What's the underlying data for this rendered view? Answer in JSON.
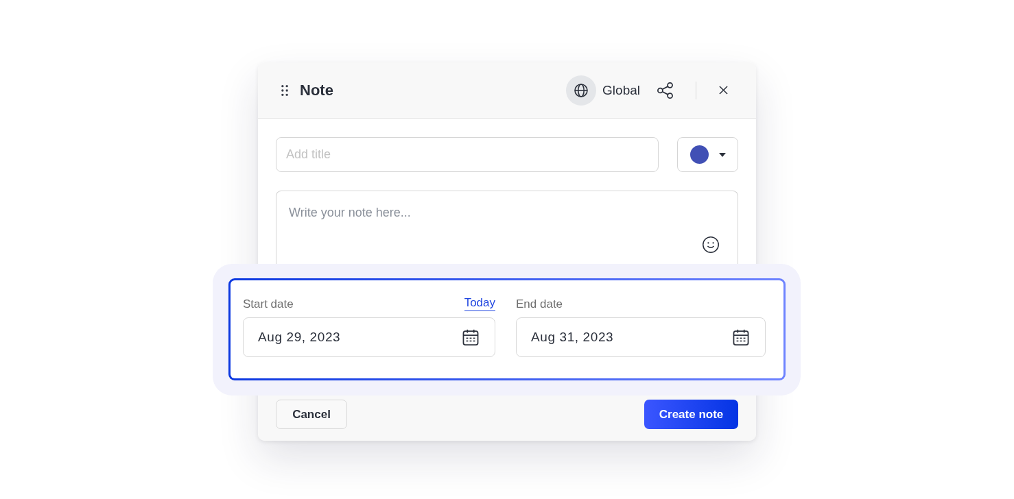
{
  "header": {
    "title": "Note",
    "visibility": "Global"
  },
  "title_field": {
    "placeholder": "Add title"
  },
  "color_picker": {
    "color": "#4150b5"
  },
  "note_field": {
    "placeholder": "Write your note here..."
  },
  "date_range": [
    {
      "label": "Start date",
      "link": "Today",
      "value": "Aug 29, 2023"
    },
    {
      "label": "End date",
      "value": "Aug 31, 2023"
    }
  ],
  "buttons": [
    {
      "label": "Cancel",
      "kind": "secondary"
    },
    {
      "label": "Create note",
      "kind": "primary"
    }
  ]
}
